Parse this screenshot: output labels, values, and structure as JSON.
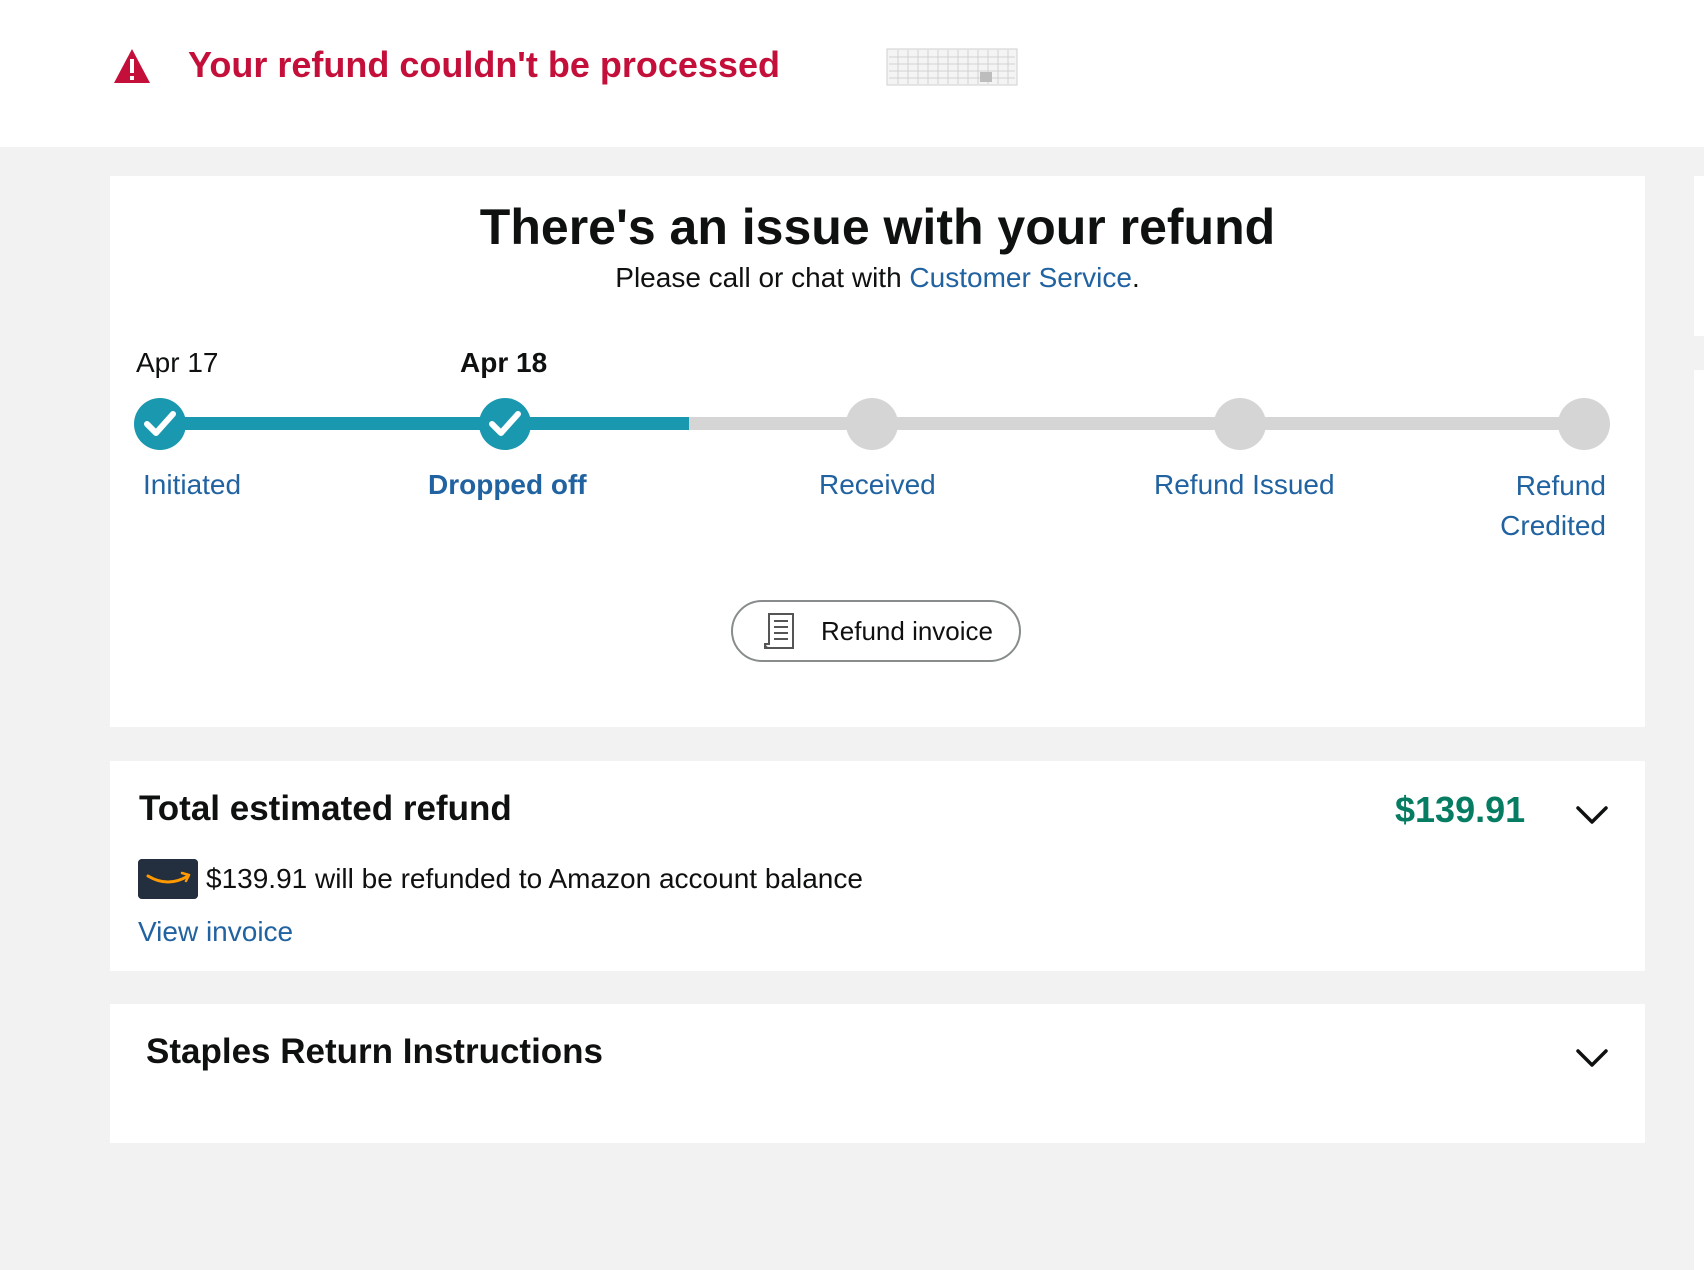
{
  "alert": {
    "message": "Your refund couldn't be processed",
    "color": "#c40f3a"
  },
  "status": {
    "title": "There's an issue with your refund",
    "subtitle_prefix": "Please call or chat with ",
    "subtitle_link": "Customer Service",
    "subtitle_suffix": "."
  },
  "tracker": {
    "progress_color": "#1a98b0",
    "steps": [
      {
        "label": "Initiated",
        "date": "Apr 17",
        "done": true
      },
      {
        "label": "Dropped off",
        "date": "Apr 18",
        "done": true,
        "current": true
      },
      {
        "label": "Received",
        "date": "",
        "done": false
      },
      {
        "label": "Refund Issued",
        "date": "",
        "done": false
      },
      {
        "label": "Refund Credited",
        "date": "",
        "done": false
      }
    ]
  },
  "invoice_button": {
    "label": "Refund invoice",
    "icon": "receipt-icon"
  },
  "refund": {
    "title": "Total estimated refund",
    "amount": "$139.91",
    "destination_text": "$139.91 will be refunded to Amazon account balance",
    "view_invoice": "View invoice",
    "amount_color": "#067d62"
  },
  "instructions": {
    "title": "Staples Return Instructions"
  }
}
